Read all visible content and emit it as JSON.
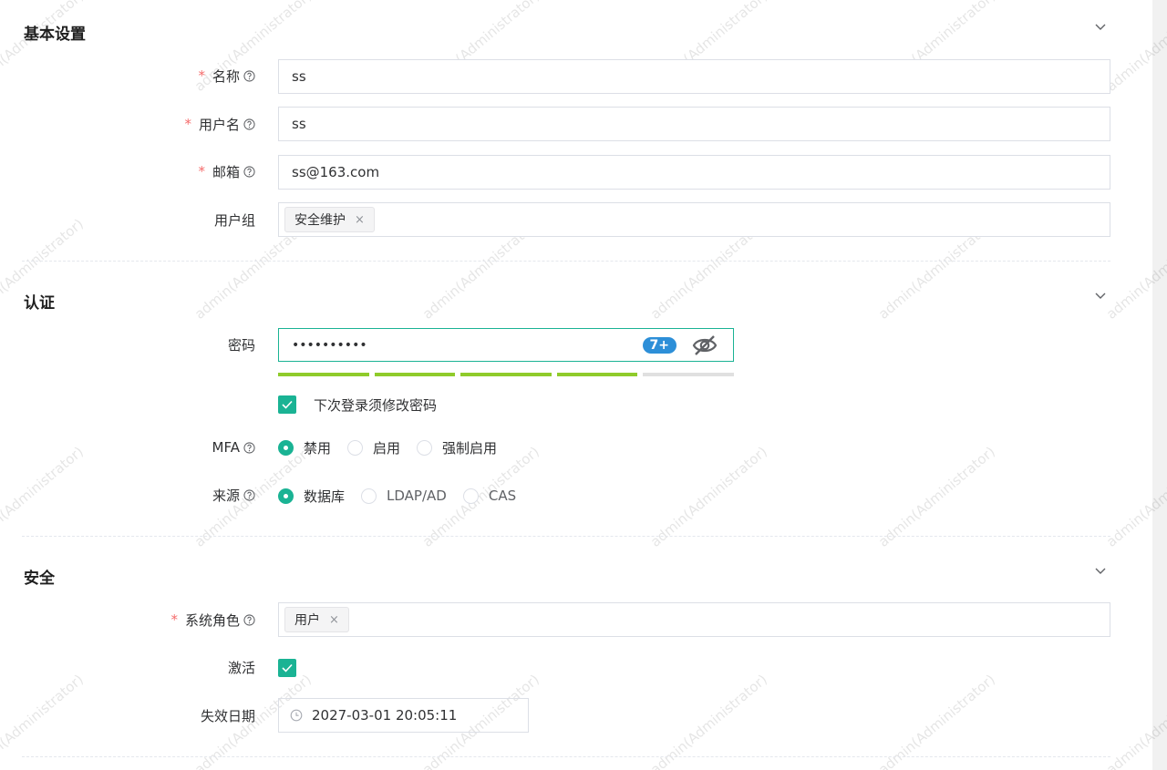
{
  "sections": {
    "basic": {
      "title": "基本设置"
    },
    "auth": {
      "title": "认证"
    },
    "security": {
      "title": "安全"
    }
  },
  "basic": {
    "name": {
      "label": "名称",
      "required": true,
      "value": "ss"
    },
    "username": {
      "label": "用户名",
      "required": true,
      "value": "ss"
    },
    "email": {
      "label": "邮箱",
      "required": true,
      "value": "ss@163.com"
    },
    "groups": {
      "label": "用户组",
      "tags": [
        "安全维护"
      ]
    }
  },
  "auth": {
    "password": {
      "label": "密码",
      "masked_value": "••••••••••",
      "score_badge": "7+",
      "strength_segments_filled": 4,
      "strength_segments_total": 5
    },
    "must_change": {
      "label": "下次登录须修改密码",
      "checked": true
    },
    "mfa": {
      "label": "MFA",
      "options": [
        "禁用",
        "启用",
        "强制启用"
      ],
      "selected": "禁用"
    },
    "source": {
      "label": "来源",
      "options": [
        "数据库",
        "LDAP/AD",
        "CAS"
      ],
      "selected": "数据库"
    }
  },
  "security": {
    "role": {
      "label": "系统角色",
      "required": true,
      "tags": [
        "用户"
      ]
    },
    "active": {
      "label": "激活",
      "checked": true
    },
    "expire": {
      "label": "失效日期",
      "value": "2027-03-01 20:05:11"
    }
  },
  "icons": {
    "help": "question-circle-icon",
    "collapse": "chevron-down-icon",
    "eye": "eye-off-icon",
    "clock": "clock-icon",
    "tag_close": "close-icon",
    "check": "check-icon"
  },
  "colors": {
    "accent": "#1ab394",
    "required": "#f56c6c",
    "strength_fill": "#8fcb2b",
    "badge": "#2d8fd8"
  },
  "watermark": "admin(Administrator)",
  "tag_close_glyph": "×"
}
